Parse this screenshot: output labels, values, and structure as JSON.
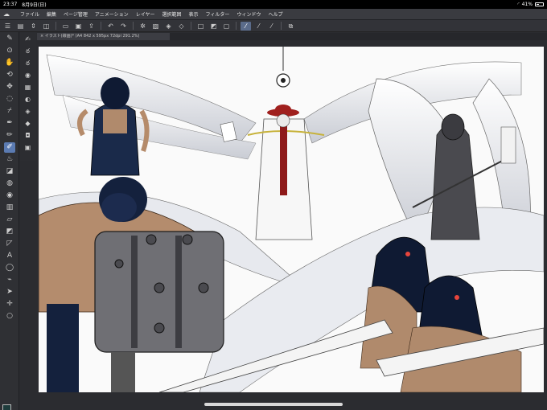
{
  "status": {
    "time": "23:37",
    "date": "8月9日(日)",
    "battery": "41%"
  },
  "menu": [
    "ファイル",
    "編集",
    "ページ管理",
    "アニメーション",
    "レイヤー",
    "選択範囲",
    "表示",
    "フィルター",
    "ウィンドウ",
    "ヘルプ"
  ],
  "tab": {
    "title": "イラスト(線画)* (A4 842 x 595px 72dpi 291.2%)"
  },
  "toolbar": {
    "icons": [
      "menu-icon",
      "save-icon",
      "undo-history-icon",
      "new-icon",
      "open-icon",
      "export-icon",
      "undo-icon",
      "redo-icon",
      "settings-icon",
      "clear-icon",
      "fill-icon",
      "transform-icon",
      "select-icon",
      "deselect-icon",
      "stabilizer-low-icon",
      "stabilizer-mid-icon",
      "stabilizer-high-icon",
      "copy-icon"
    ]
  },
  "tools": [
    "tool-option",
    "zoom",
    "hand",
    "rotate",
    "move",
    "lasso",
    "eyedropper",
    "pen",
    "pencil",
    "brush",
    "airbrush",
    "eraser",
    "blend",
    "fill",
    "gradient",
    "figure",
    "frame",
    "ruler",
    "text",
    "balloon",
    "correction",
    "operation",
    "move-layer"
  ],
  "colors": {
    "main": "#1e3c3c",
    "sub": "#ffffff"
  }
}
